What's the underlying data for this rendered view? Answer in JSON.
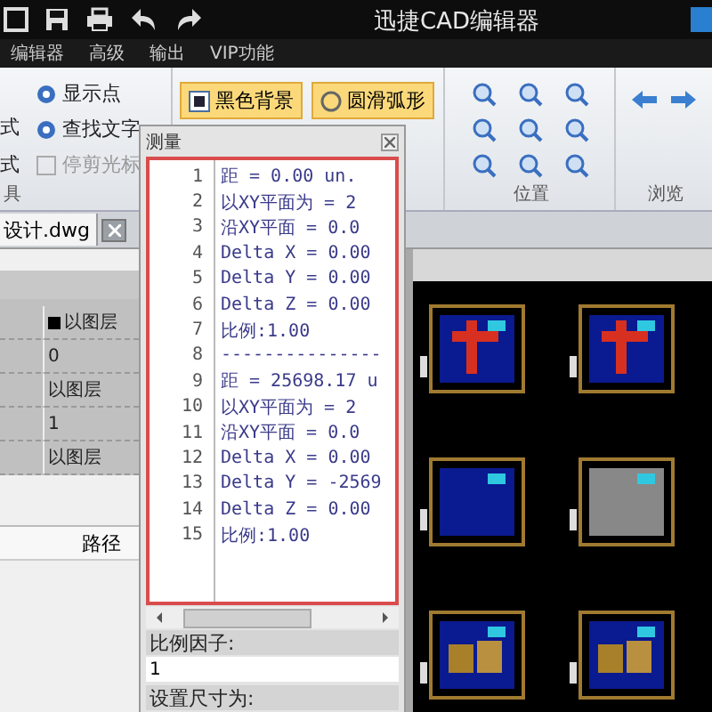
{
  "window": {
    "title": "迅捷CAD编辑器"
  },
  "menu": [
    {
      "label": "编辑器"
    },
    {
      "label": "高级"
    },
    {
      "label": "输出"
    },
    {
      "label": "VIP功能"
    }
  ],
  "ribbon": {
    "tools": {
      "side_labels": [
        "式",
        "式"
      ],
      "items": [
        {
          "label": "显示点",
          "disabled": false
        },
        {
          "label": "查找文字",
          "disabled": false
        },
        {
          "label": "停剪光标",
          "disabled": true
        }
      ],
      "group_label": "具"
    },
    "view": {
      "items": [
        {
          "label": "黑色背景",
          "on": true
        },
        {
          "label": "圆滑弧形",
          "on": true
        }
      ]
    },
    "position": {
      "group_label": "位置"
    },
    "browse": {
      "group_label": "浏览"
    }
  },
  "document_tab": {
    "label": "设计.dwg"
  },
  "properties": {
    "rows": [
      {
        "kind": "swatch",
        "value": "以图层"
      },
      {
        "kind": "text",
        "value": "0"
      },
      {
        "kind": "text",
        "value": "以图层"
      },
      {
        "kind": "text",
        "value": "1"
      },
      {
        "kind": "text",
        "value": "以图层"
      }
    ],
    "path_header": "路径"
  },
  "measure_dialog": {
    "title": "测量",
    "lines": [
      {
        "number": "1",
        "text": "距 = 0.00 un."
      },
      {
        "number": "2",
        "text": "以XY平面为 = 2"
      },
      {
        "number": "3",
        "text": "沿XY平面 = 0.0"
      },
      {
        "number": "4",
        "text": "Delta X = 0.00"
      },
      {
        "number": "5",
        "text": "Delta Y = 0.00"
      },
      {
        "number": "6",
        "text": "Delta Z = 0.00"
      },
      {
        "number": "7",
        "text": "比例:1.00"
      },
      {
        "number": "8",
        "text": "---------------"
      },
      {
        "number": "9",
        "text": "距 = 25698.17 u"
      },
      {
        "number": "10",
        "text": "以XY平面为 = 2"
      },
      {
        "number": "11",
        "text": "沿XY平面 = 0.0"
      },
      {
        "number": "12",
        "text": "Delta X = 0.00"
      },
      {
        "number": "13",
        "text": "Delta Y = -2569"
      },
      {
        "number": "14",
        "text": "Delta Z = 0.00"
      },
      {
        "number": "15",
        "text": "比例:1.00"
      }
    ],
    "scale_label": "比例因子:",
    "scale_value": "1",
    "size_label": "设置尺寸为:"
  }
}
